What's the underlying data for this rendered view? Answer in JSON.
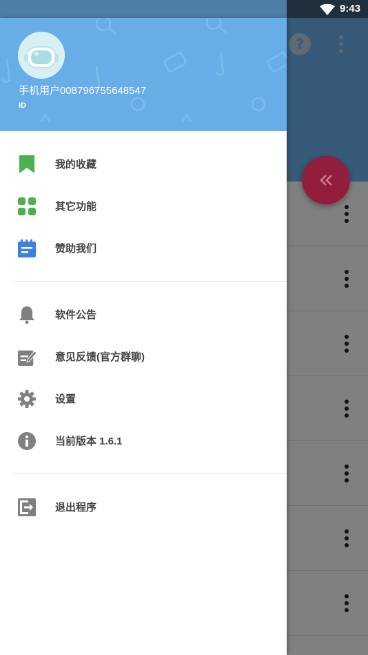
{
  "status_bar": {
    "time": "9:43"
  },
  "drawer": {
    "header": {
      "user_name": "手机用户008796755648547",
      "user_id_label": "ID"
    },
    "section1": [
      {
        "label": "我的收藏",
        "icon": "bookmark-icon",
        "color": "#4caf50"
      },
      {
        "label": "其它功能",
        "icon": "apps-grid-icon",
        "color": "#4caf50"
      },
      {
        "label": "赞助我们",
        "icon": "notepad-icon",
        "color": "#3f7fe0"
      }
    ],
    "section2": [
      {
        "label": "软件公告",
        "icon": "bell-icon"
      },
      {
        "label": "意见反馈(官方群聊)",
        "icon": "feedback-edit-icon"
      },
      {
        "label": "设置",
        "icon": "gear-icon"
      },
      {
        "label": "当前版本 1.6.1",
        "icon": "info-icon"
      }
    ],
    "section3": [
      {
        "label": "退出程序",
        "icon": "exit-icon"
      }
    ]
  },
  "background_app": {
    "fab_icon": "double-chevron-left-icon",
    "fab_color": "#921d3d",
    "header_color": "#365a78",
    "row_count": 7
  },
  "colors": {
    "drawer_header": "#67ade8",
    "icon_gray": "#808080",
    "menu_text": "#424242"
  }
}
